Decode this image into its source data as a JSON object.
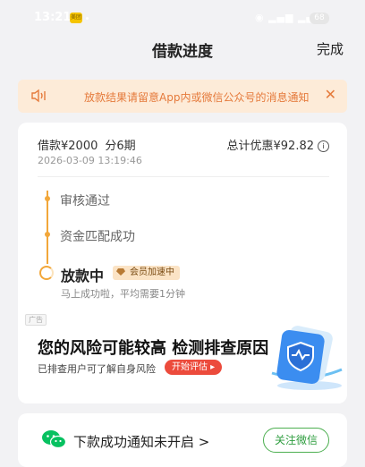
{
  "status_bar": {
    "time": "13:21",
    "app_badge": "美团",
    "battery": "68"
  },
  "nav": {
    "title": "借款进度",
    "done": "完成"
  },
  "notice": {
    "text": "放款结果请留意App内或微信公众号的消息通知",
    "close": "✕"
  },
  "loan": {
    "amount": "借款¥2000",
    "period": "分6期",
    "time": "2026-03-09 13:19:46",
    "discount": "总计优惠¥92.82",
    "info_icon": "i"
  },
  "timeline": {
    "steps": [
      {
        "label": "审核通过"
      },
      {
        "label": "资金匹配成功"
      }
    ],
    "current": {
      "label": "放款中",
      "badge": "会员加速中",
      "sub": "马上成功啦，平均需要1分钟"
    }
  },
  "ad": {
    "tag": "广告",
    "title": "您的风险可能较高 检测排查原因",
    "subtitle": "已排查用户可了解自身风险",
    "button": "开始评估 ▸"
  },
  "bottom": {
    "text": "下款成功通知未开启 >",
    "button": "关注微信"
  },
  "colors": {
    "accent": "#f2a73a",
    "notice_bg": "#fdebd8",
    "notice_text": "#e57a3b",
    "ad_button": "#ec4b3c",
    "wechat_green": "#4caf50"
  }
}
